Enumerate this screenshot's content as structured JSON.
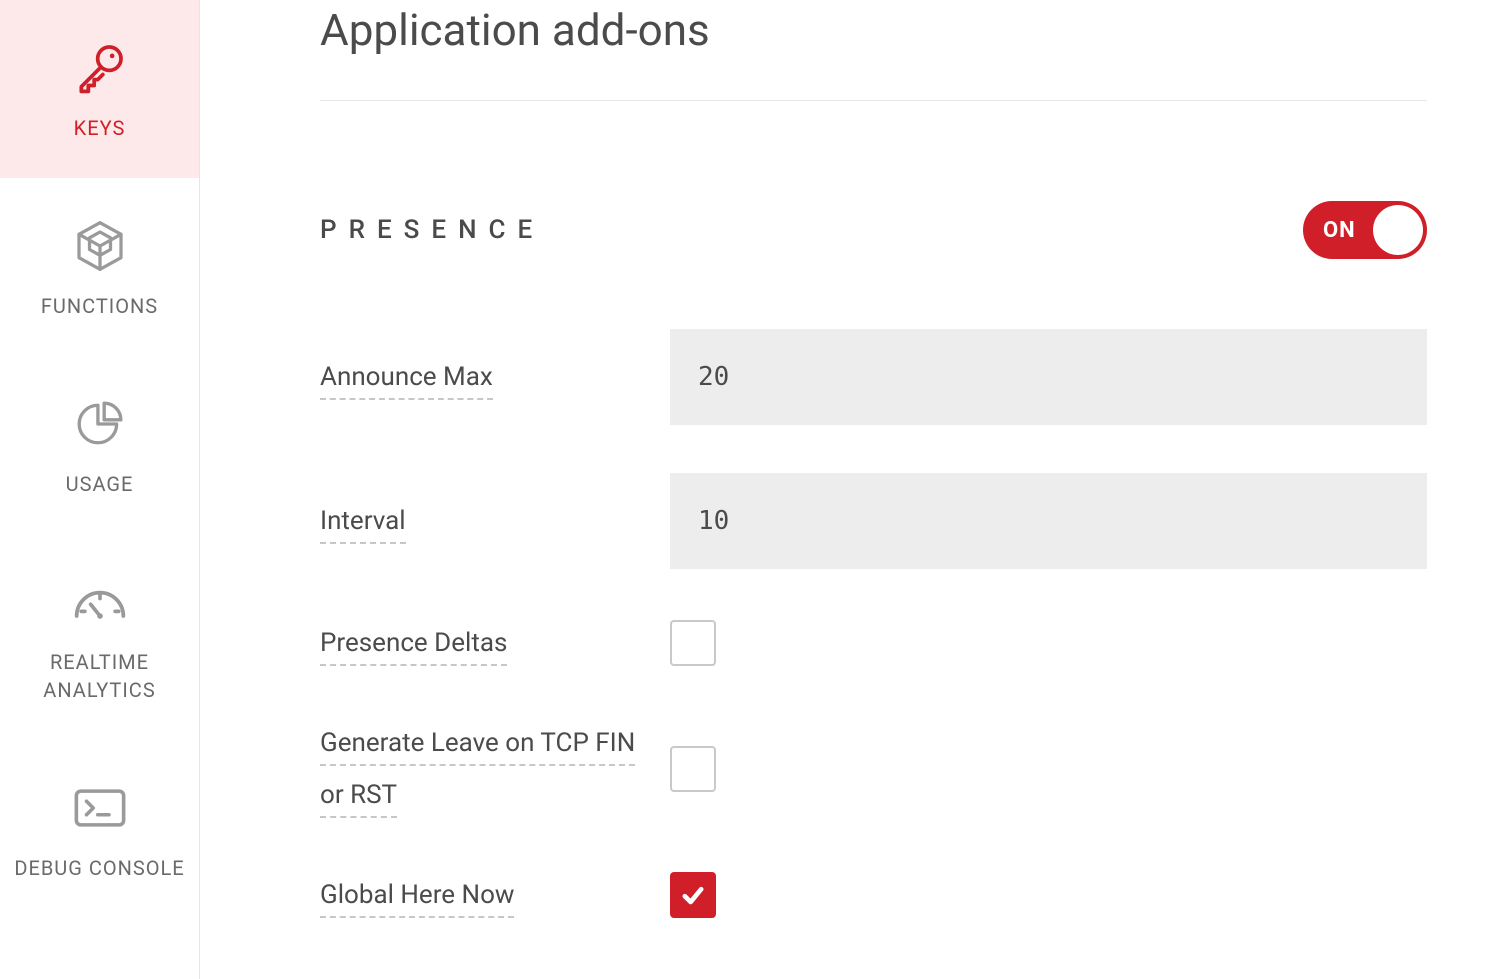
{
  "colors": {
    "accent": "#d01f29",
    "accent_bg": "#fde9e9",
    "input_bg": "#ededed",
    "text": "#4b4b4b",
    "muted": "#6a6a6a"
  },
  "sidebar": {
    "items": [
      {
        "id": "keys",
        "label": "KEYS",
        "icon": "key-icon",
        "active": true
      },
      {
        "id": "functions",
        "label": "FUNCTIONS",
        "icon": "cube-icon",
        "active": false
      },
      {
        "id": "usage",
        "label": "USAGE",
        "icon": "pie-chart-icon",
        "active": false
      },
      {
        "id": "realtime-analytics",
        "label": "REALTIME ANALYTICS",
        "icon": "gauge-icon",
        "active": false
      },
      {
        "id": "debug-console",
        "label": "DEBUG CONSOLE",
        "icon": "terminal-icon",
        "active": false
      }
    ]
  },
  "page": {
    "title": "Application add-ons"
  },
  "presence": {
    "section_title": "PRESENCE",
    "toggle": {
      "state_label": "ON",
      "on": true
    },
    "fields": {
      "announce_max": {
        "label": "Announce Max",
        "value": "20"
      },
      "interval": {
        "label": "Interval",
        "value": "10"
      },
      "presence_deltas": {
        "label": "Presence Deltas",
        "checked": false
      },
      "generate_leave": {
        "label": "Generate Leave on TCP FIN or RST",
        "checked": false
      },
      "global_here_now": {
        "label": "Global Here Now",
        "checked": true
      }
    }
  }
}
